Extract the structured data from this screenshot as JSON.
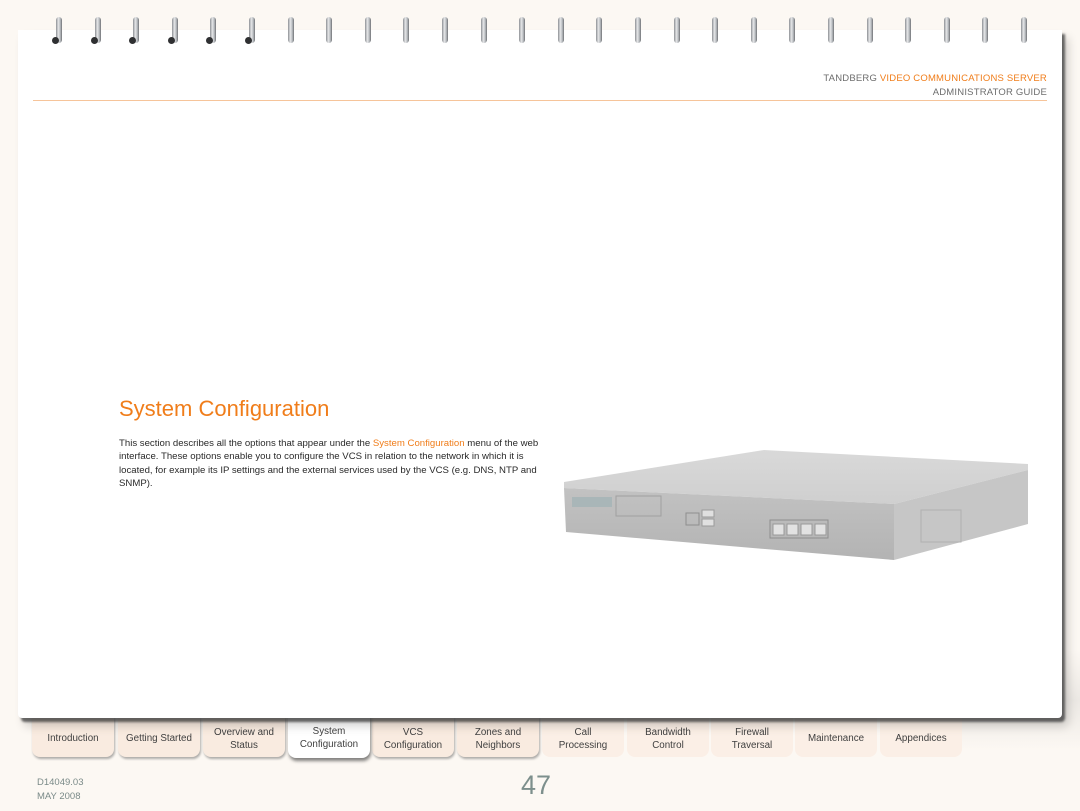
{
  "header": {
    "brand_prefix": "TANDBERG",
    "brand_accent": "VIDEO COMMUNICATIONS SERVER",
    "guide": "ADMINISTRATOR GUIDE"
  },
  "section": {
    "title": "System Configuration",
    "body_before_link": "This section describes all the options that appear under the ",
    "body_link": "System Configuration",
    "body_after_link": " menu of the web interface.  These options enable you to configure the VCS in relation to the network in which it is located, for example its IP settings and the external services used by the VCS (e.g. DNS, NTP and SNMP)."
  },
  "illustration": {
    "icon": "vcs-server-appliance-image"
  },
  "tabs": [
    {
      "label": "Introduction",
      "active": false
    },
    {
      "label": "Getting Started",
      "active": false
    },
    {
      "label": "Overview and\nStatus",
      "active": false
    },
    {
      "label": "System\nConfiguration",
      "active": true
    },
    {
      "label": "VCS\nConfiguration",
      "active": false
    },
    {
      "label": "Zones and\nNeighbors",
      "active": false
    },
    {
      "label": "Call\nProcessing",
      "active": false
    },
    {
      "label": "Bandwidth\nControl",
      "active": false
    },
    {
      "label": "Firewall\nTraversal",
      "active": false
    },
    {
      "label": "Maintenance",
      "active": false
    },
    {
      "label": "Appendices",
      "active": false
    }
  ],
  "footer": {
    "doc_id": "D14049.03",
    "date": "MAY 2008",
    "page_number": "47"
  },
  "colors": {
    "accent": "#f07d1a",
    "rule": "#f6c49a",
    "tab_bg": "#f9ebe0",
    "page_bg": "#fcf8f3"
  }
}
